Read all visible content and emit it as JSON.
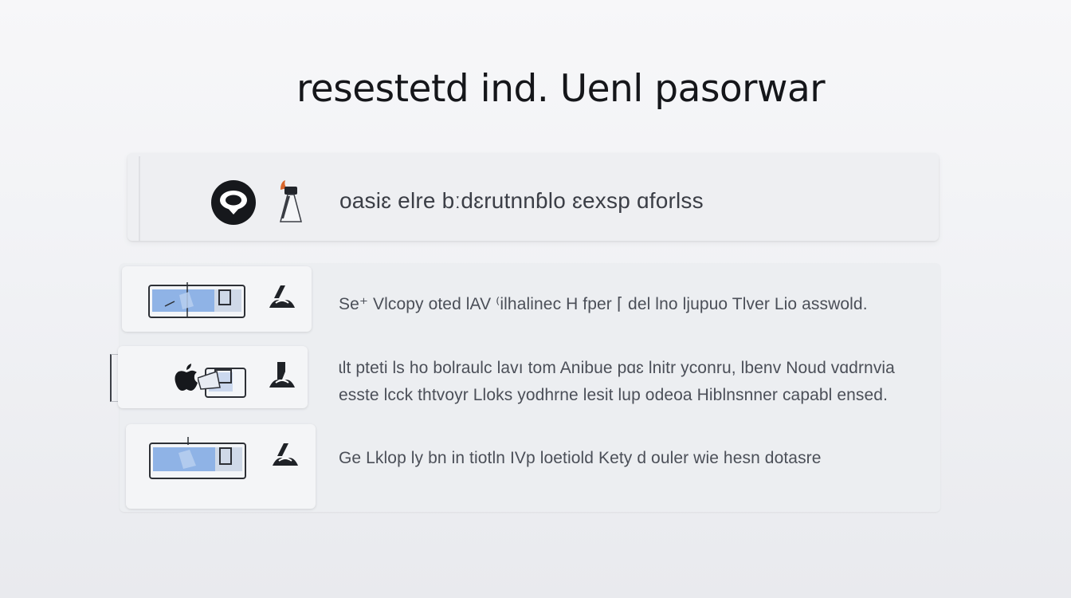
{
  "title": "resestetd ind. Uenl pasorwar",
  "top_card": {
    "text": "oasiɛ elre bːdɛrutnnɓlo ɛexsp ɑforlss",
    "icons": [
      "circle-badge-icon",
      "flask-flame-icon"
    ]
  },
  "rows": [
    {
      "lines": [
        "Se⁺ Vlcopy oted lAV ⁽ilhalinec H fper ⌈ del lno ljupuo Tlver Lio asswold."
      ],
      "icons": [
        "device-screen-icon",
        "stand-icon"
      ]
    },
    {
      "lines": [
        "ɩlt pteti ls ho bolraulc lavı tom Anibue pɑɛ lnitr yconru, lbenv Noud vɑdrnvia",
        "esste lcck thtvoyr Lloks yodhrne lesit lup odeoa Hiblnsnner capabl ensed."
      ],
      "icons": [
        "apple-logo-icon",
        "device-screen-icon",
        "stand-icon"
      ]
    },
    {
      "lines": [
        "Ge Lklop ly bn in tiotln IVp loetiold Kety d ouler wie hesn dotasre"
      ],
      "icons": [
        "device-screen-icon",
        "stand-icon"
      ]
    }
  ],
  "colors": {
    "background": "#f1f2f5",
    "card": "#eeeff2",
    "title": "#15161a",
    "text": "#4b4f58",
    "accent_blue": "#8fb3e6",
    "accent_orange": "#d9662b"
  }
}
